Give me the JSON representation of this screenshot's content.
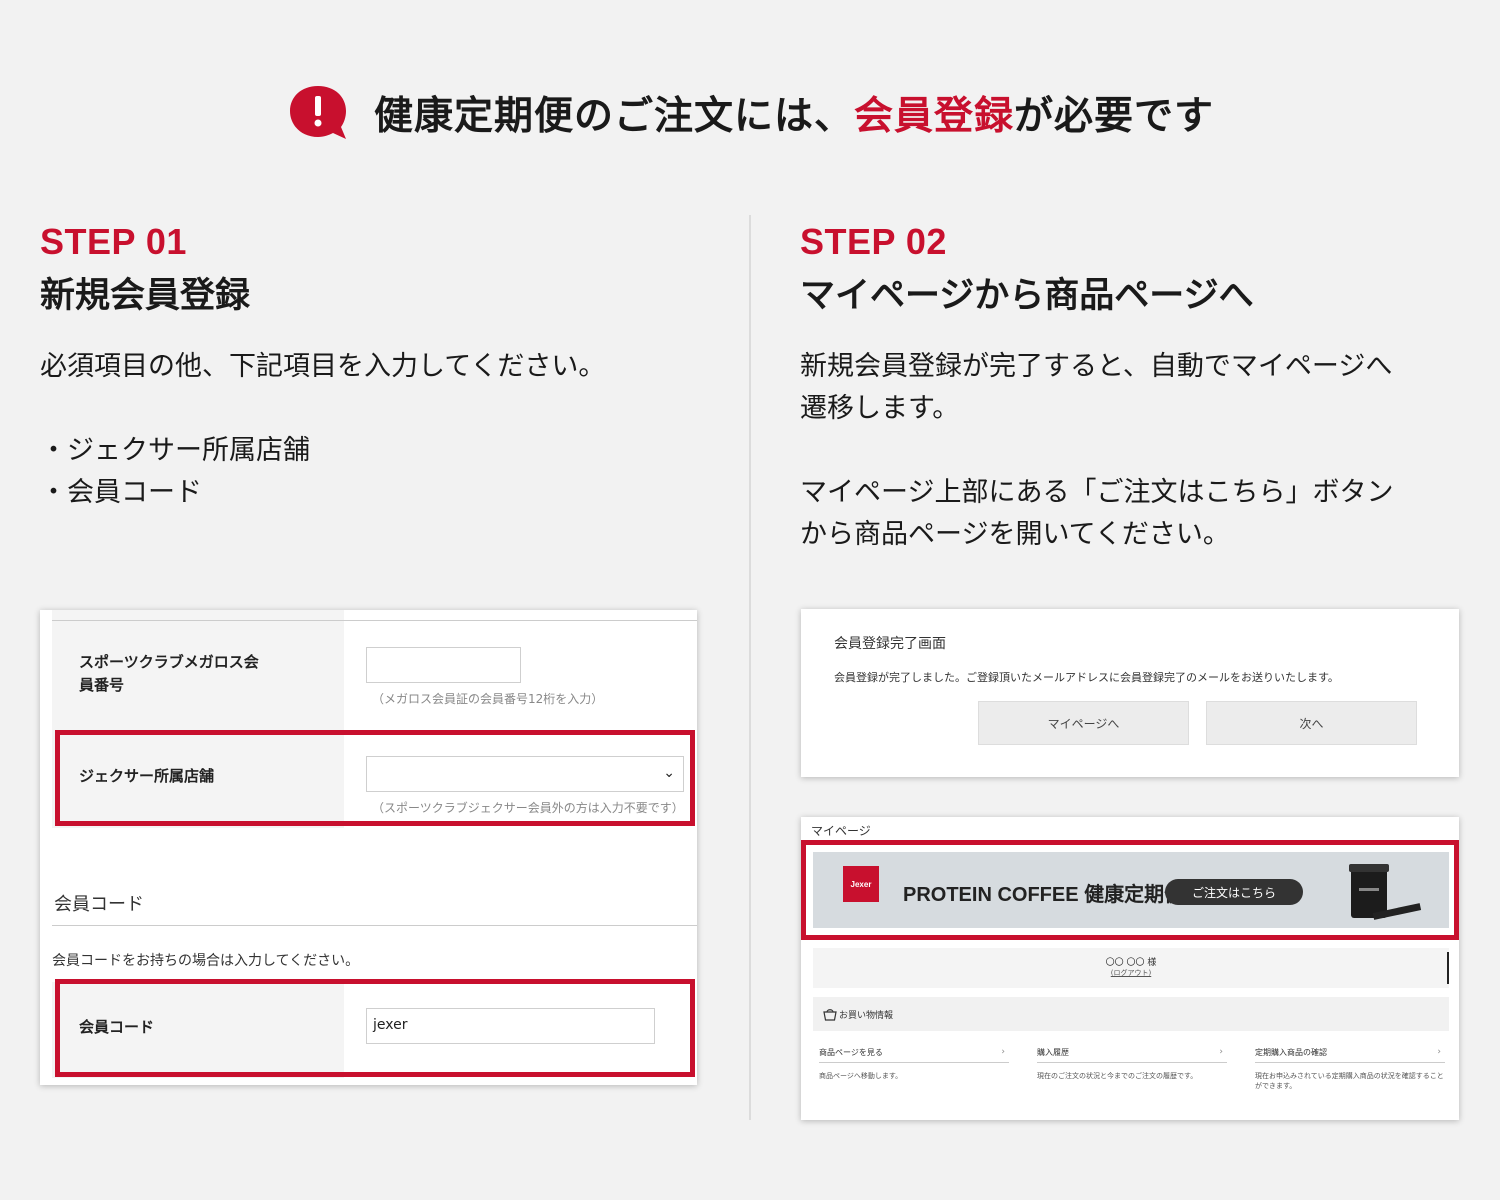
{
  "header": {
    "prefix": "健康定期便のご注文には、",
    "accent": "会員登録",
    "suffix": "が必要です",
    "icon": "exclamation-bubble-icon",
    "accent_color": "#c8102e"
  },
  "step1": {
    "label": "STEP 01",
    "title": "新規会員登録",
    "desc": "必須項目の他、下記項目を入力してください。",
    "bullets": [
      "・ジェクサー所属店舗",
      "・会員コード"
    ]
  },
  "step2": {
    "label": "STEP 02",
    "title": "マイページから商品ページへ",
    "desc_lines_1": [
      "新規会員登録が完了すると、自動でマイページへ",
      "遷移します。"
    ],
    "desc_lines_2": [
      "マイページ上部にある「ご注文はこちら」ボタン",
      "から商品ページを開いてください。"
    ]
  },
  "form": {
    "megalos_label_1": "スポーツクラブメガロス会",
    "megalos_label_2": "員番号",
    "megalos_hint": "（メガロス会員証の会員番号12桁を入力）",
    "store_label": "ジェクサー所属店舗",
    "store_hint": "（スポーツクラブジェクサー会員外の方は入力不要です）",
    "code_section": "会員コード",
    "code_note": "会員コードをお持ちの場合は入力してください。",
    "code_label": "会員コード",
    "code_value": "jexer"
  },
  "done": {
    "title": "会員登録完了画面",
    "message": "会員登録が完了しました。ご登録頂いたメールアドレスに会員登録完了のメールをお送りいたします。",
    "btn_mypage": "マイページへ",
    "btn_next": "次へ"
  },
  "mypage": {
    "label": "マイページ",
    "logo": "Jexer",
    "banner_title": "PROTEIN COFFEE 健康定期便",
    "order_button": "ご注文はこちら",
    "user": "〇〇 〇〇 様",
    "logout": "(ログアウト)",
    "info_title": "お買い物情報",
    "links": [
      {
        "title": "商品ページを見る",
        "desc": "商品ページへ移動します。"
      },
      {
        "title": "購入履歴",
        "desc": "現在のご注文の状況と今までのご注文の履歴です。"
      },
      {
        "title": "定期購入商品の確認",
        "desc": "現在お申込みされている定期購入商品の状況を確認することができます。"
      }
    ]
  }
}
